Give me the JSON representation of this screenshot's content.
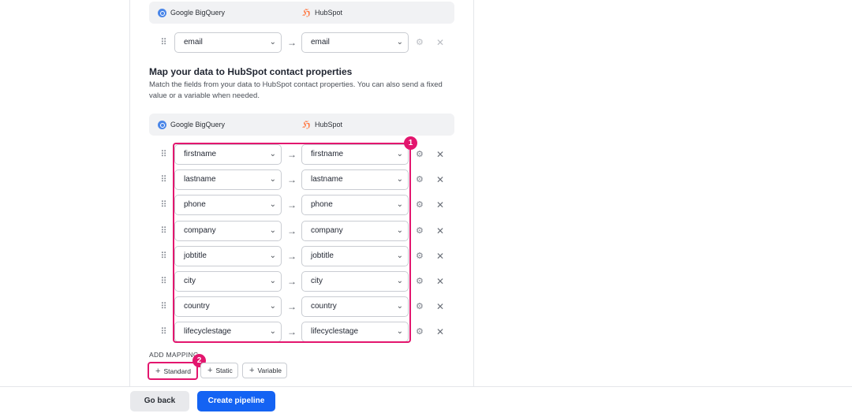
{
  "identity_section": {
    "source_label": "Google BigQuery",
    "destination_label": "HubSpot",
    "row": {
      "source_field": "email",
      "destination_field": "email"
    }
  },
  "mapping_section": {
    "title": "Map your data to HubSpot contact properties",
    "description": "Match the fields from your data to HubSpot contact properties. You can also send a fixed value or a variable when needed.",
    "source_label": "Google BigQuery",
    "destination_label": "HubSpot",
    "rows": [
      {
        "source_field": "firstname",
        "destination_field": "firstname"
      },
      {
        "source_field": "lastname",
        "destination_field": "lastname"
      },
      {
        "source_field": "phone",
        "destination_field": "phone"
      },
      {
        "source_field": "company",
        "destination_field": "company"
      },
      {
        "source_field": "jobtitle",
        "destination_field": "jobtitle"
      },
      {
        "source_field": "city",
        "destination_field": "city"
      },
      {
        "source_field": "country",
        "destination_field": "country"
      },
      {
        "source_field": "lifecyclestage",
        "destination_field": "lifecyclestage"
      }
    ]
  },
  "add_mapping": {
    "label": "ADD MAPPING",
    "buttons": {
      "standard": "Standard",
      "static": "Static",
      "variable": "Variable"
    }
  },
  "annotations": {
    "badge_1": "1",
    "badge_2": "2",
    "color": "#e3166e"
  },
  "footer": {
    "back_label": "Go back",
    "create_label": "Create pipeline",
    "accent_color": "#1463f3"
  },
  "icons": {
    "drag": "⠿",
    "chevron": "⌄",
    "arrow": "→",
    "gear": "⚙",
    "close": "✕",
    "plus": "+"
  }
}
